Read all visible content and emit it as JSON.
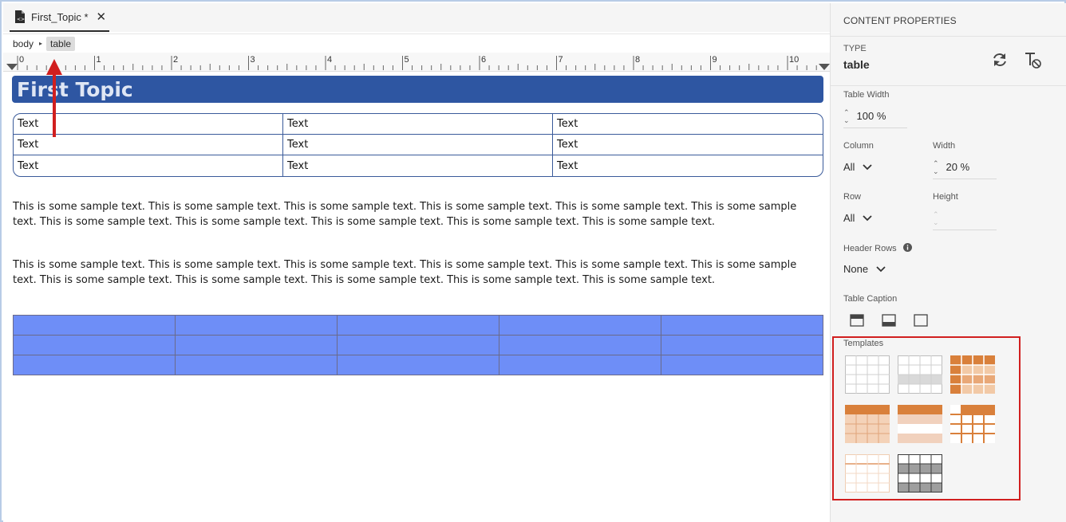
{
  "editor": {
    "tab": {
      "title": "First_Topic *",
      "close": "✕",
      "file_icon": "html-file-icon"
    },
    "breadcrumb": {
      "items": [
        "body",
        "table"
      ],
      "separator": "▸"
    },
    "ruler": {
      "labels": [
        "0",
        "1",
        "2",
        "3",
        "4",
        "5",
        "6",
        "7",
        "8",
        "9",
        "10"
      ]
    },
    "title": "First Topic",
    "table1": {
      "rows": [
        [
          "Text",
          "Text",
          "Text"
        ],
        [
          "Text",
          "Text",
          "Text"
        ],
        [
          "Text",
          "Text",
          "Text"
        ]
      ]
    },
    "paragraphs": [
      "This is some sample text. This is some sample text. This is some sample text. This is some sample text. This is some sample text. This is some sample text. This is some sample text. This is some sample text. This is some sample text. This is some sample text. This is some sample text.",
      "This is some sample text. This is some sample text. This is some sample text. This is some sample text. This is some sample text. This is some sample text. This is some sample text. This is some sample text. This is some sample text. This is some sample text. This is some sample text."
    ],
    "table2": {
      "rows": 3,
      "cols": 5,
      "fill_color": "#6e8ef7"
    }
  },
  "panel": {
    "heading": "CONTENT PROPERTIES",
    "type_label": "TYPE",
    "type_value": "table",
    "table_width_label": "Table Width",
    "table_width_value": "100 %",
    "column_label": "Column",
    "column_value": "All",
    "width_label": "Width",
    "width_value": "20 %",
    "row_label": "Row",
    "row_value": "All",
    "height_label": "Height",
    "height_value": "",
    "header_rows_label": "Header Rows",
    "header_rows_value": "None",
    "table_caption_label": "Table Caption",
    "templates_label": "Templates"
  },
  "colors": {
    "title_bar": "#2e56a2",
    "highlight_box": "#d11f1f",
    "arrow": "#d11f1f",
    "template_orange": "#d9803b"
  }
}
